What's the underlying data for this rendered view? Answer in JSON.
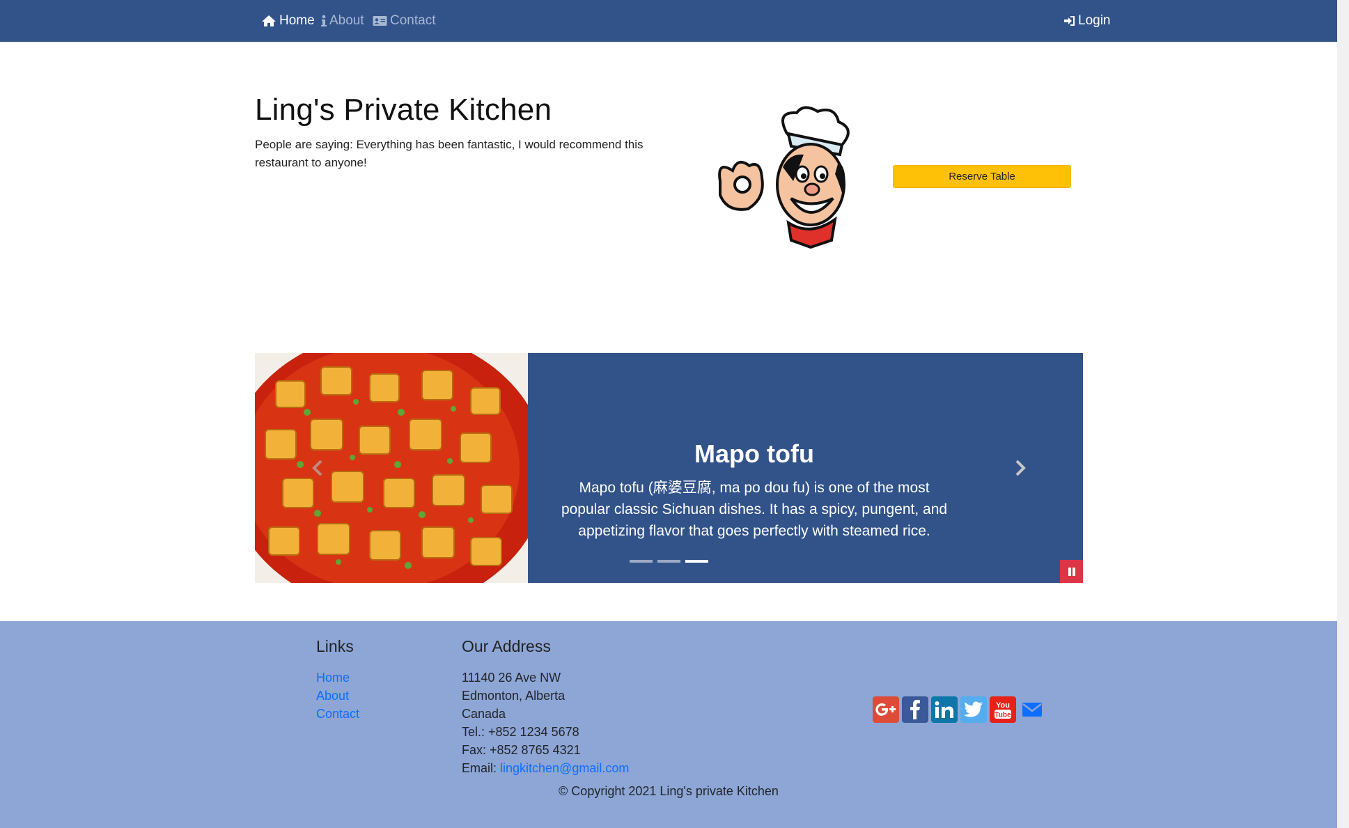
{
  "nav": {
    "home": "Home",
    "about": "About",
    "contact": "Contact",
    "login": "Login"
  },
  "hero": {
    "title": "Ling's Private Kitchen",
    "subtitle": "People are saying: Everything has been fantastic, I would recommend this restaurant to anyone!",
    "reserve_label": "Reserve Table"
  },
  "carousel": {
    "slide_title": "Mapo tofu",
    "slide_text": "Mapo tofu (麻婆豆腐, ma po dou fu) is one of the most popular classic Sichuan dishes. It has a spicy, pungent, and appetizing flavor that goes perfectly with steamed rice.",
    "active_index": 2,
    "indicator_count": 3
  },
  "footer": {
    "links_heading": "Links",
    "links": [
      "Home",
      "About",
      "Contact"
    ],
    "address_heading": "Our Address",
    "address_lines": [
      "11140 26 Ave NW",
      "Edmonton, Alberta",
      "Canada",
      "Tel.: +852 1234 5678",
      "Fax: +852 8765 4321"
    ],
    "email_label": "Email: ",
    "email": "lingkitchen@gmail.com",
    "social": [
      "google-plus-icon",
      "facebook-icon",
      "linkedin-icon",
      "twitter-icon",
      "youtube-icon",
      "envelope-icon"
    ],
    "copyright": "© Copyright 2021 Ling's private Kitchen"
  },
  "colors": {
    "navbar": "#32538a",
    "reserve_button": "#ffc107",
    "footer": "#8da6d6",
    "link": "#0d6efd",
    "pause_button": "#dc3545"
  }
}
